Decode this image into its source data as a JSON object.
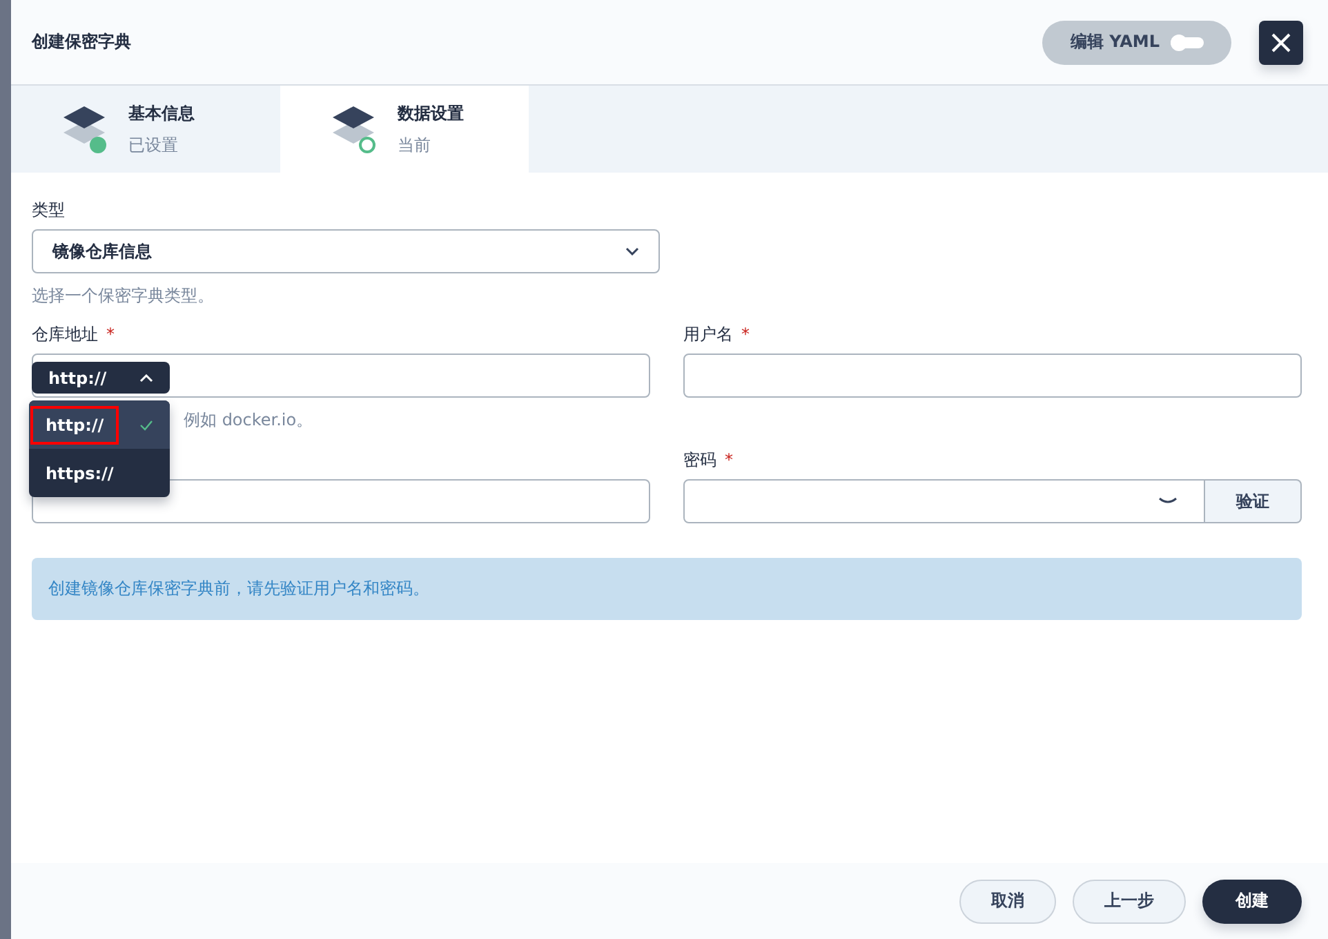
{
  "header": {
    "title": "创建保密字典",
    "yaml_toggle": {
      "label": "编辑 YAML",
      "on": false
    }
  },
  "steps": [
    {
      "title": "基本信息",
      "status": "已设置",
      "kind": "done",
      "selected": false
    },
    {
      "title": "数据设置",
      "status": "当前",
      "kind": "current",
      "selected": true
    }
  ],
  "form": {
    "type_field": {
      "label": "类型",
      "value": "镜像仓库信息",
      "hint": "选择一个保密字典类型。"
    },
    "registry": {
      "label": "仓库地址",
      "required_mark": "*",
      "protocol": {
        "value": "http://",
        "expanded": true,
        "options": [
          {
            "label": "http://",
            "selected": true,
            "highlighted": true
          },
          {
            "label": "https://",
            "selected": false,
            "highlighted": false
          }
        ]
      },
      "hint": "例如 docker.io。"
    },
    "username": {
      "label": "用户名",
      "required_mark": "*"
    },
    "password": {
      "label": "密码",
      "required_mark": "*",
      "button": "验证"
    },
    "notice": "创建镜像仓库保密字典前，请先验证用户名和密码。"
  },
  "footer": {
    "buttons": [
      {
        "label": "取消",
        "kind": "secondary"
      },
      {
        "label": "上一步",
        "kind": "secondary"
      },
      {
        "label": "创建",
        "kind": "primary"
      }
    ]
  }
}
